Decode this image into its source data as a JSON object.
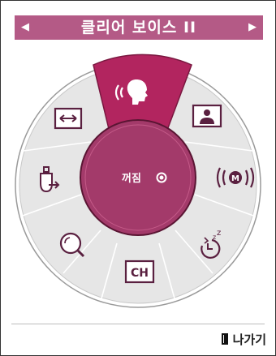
{
  "title_bar": {
    "title": "클리어 보이스 II",
    "prev_arrow": "◀",
    "next_arrow": "▶"
  },
  "center": {
    "status": "꺼짐"
  },
  "menu_items": {
    "clear_voice": "clear-voice-icon",
    "picture": "picture-icon",
    "sound_mode": "sound-mode-icon",
    "sleep_timer": "sleep-timer-icon",
    "channel": "CH",
    "zoom": "zoom-icon",
    "input": "input-icon",
    "aspect_ratio": "aspect-ratio-icon"
  },
  "exit": {
    "label": "나가기"
  },
  "colors": {
    "accent": "#b2255f",
    "title_bar": "#b45a86",
    "center": "#a33a6a",
    "wheel": "#e5e5e5",
    "icon": "#5a2040"
  }
}
